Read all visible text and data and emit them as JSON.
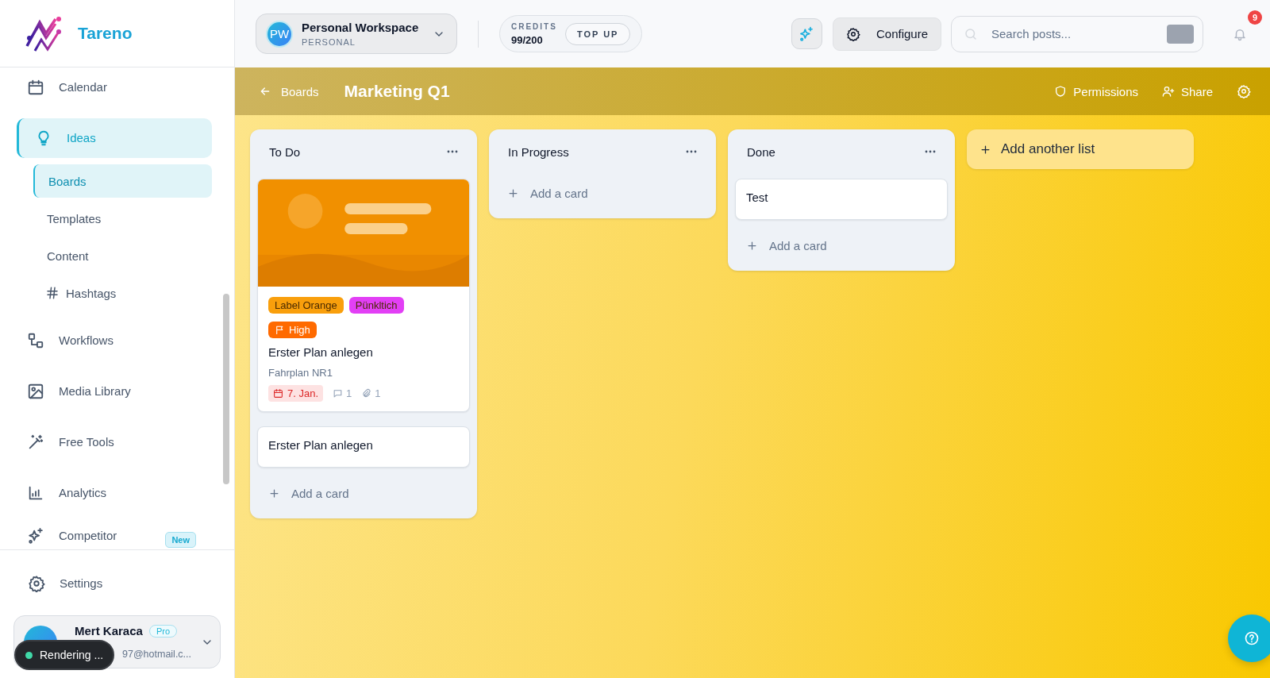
{
  "sidebar": {
    "brand": "Tareno",
    "nav": [
      {
        "label": "Calendar",
        "selected": false
      },
      {
        "label": "Ideas",
        "selected": true,
        "children": [
          {
            "label": "Boards",
            "selected": true
          },
          {
            "label": "Templates",
            "selected": false
          },
          {
            "label": "Content",
            "selected": false
          },
          {
            "label": "Hashtags",
            "selected": false
          }
        ]
      },
      {
        "label": "Workflows",
        "selected": false
      },
      {
        "label": "Media Library",
        "selected": false
      },
      {
        "label": "Free Tools",
        "selected": false
      },
      {
        "label": "Analytics",
        "selected": false
      },
      {
        "label": "Competitor",
        "selected": false,
        "badge": "New"
      }
    ],
    "settings": "Settings",
    "user": {
      "name": "Mert Karaca",
      "plan": "Pro",
      "email": "97@hotmail.c..."
    }
  },
  "header": {
    "workspace": {
      "initials": "PW",
      "name": "Personal Workspace",
      "type": "PERSONAL"
    },
    "credits": {
      "label": "CREDITS",
      "value": "99/200",
      "button": "TOP UP"
    },
    "configure": "Configure",
    "search": {
      "placeholder": "Search posts..."
    },
    "notifications": "9"
  },
  "board": {
    "back": "Boards",
    "title": "Marketing Q1",
    "actions": [
      "Permissions",
      "Share"
    ],
    "lists": [
      {
        "title": "To Do",
        "cards": [
          {
            "kind": "detailed",
            "cover": {
              "kind": "picture"
            },
            "labels": [
              {
                "text": "Label Orange",
                "color": "#f99f0c"
              },
              {
                "text": "Pünkltich",
                "color": "#e23ff5"
              }
            ],
            "priority": "High",
            "title": "Erster Plan anlegen",
            "subtitle": "Fahrplan NR1",
            "due": "7. Jan.",
            "overdue": true,
            "comments": "1",
            "attachments": "1"
          },
          {
            "kind": "simple",
            "title": "Erster Plan anlegen"
          }
        ],
        "add": "Add a card"
      },
      {
        "title": "In Progress",
        "add": "Add a card"
      },
      {
        "title": "Done",
        "cards": [
          {
            "kind": "simple",
            "title": "Test"
          }
        ],
        "add": "Add a card"
      }
    ],
    "add_list": "Add another list"
  },
  "toast": {
    "text": "Rendering ..."
  }
}
